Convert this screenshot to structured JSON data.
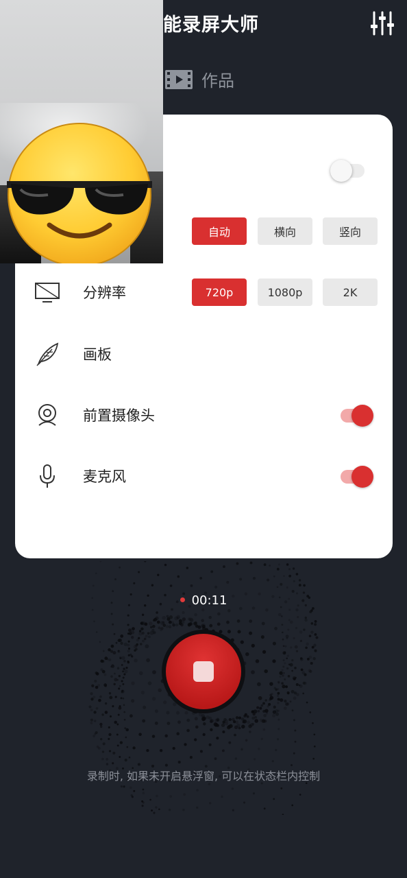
{
  "header": {
    "title": "全能录屏大师",
    "settings_icon": "sliders-icon"
  },
  "tabs": [
    {
      "label": "作品",
      "icon": "film-icon"
    }
  ],
  "settings": {
    "floating_window_toggle": {
      "on": false
    },
    "orientation": {
      "options": [
        "自动",
        "横向",
        "竖向"
      ],
      "selected": "自动"
    },
    "resolution": {
      "label": "分辨率",
      "icon": "monitor-icon",
      "options": [
        "720p",
        "1080p",
        "2K"
      ],
      "selected": "720p"
    },
    "canvas": {
      "label": "画板",
      "icon": "feather-icon"
    },
    "front_camera": {
      "label": "前置摄像头",
      "icon": "webcam-icon",
      "on": true
    },
    "microphone": {
      "label": "麦克风",
      "icon": "microphone-icon",
      "on": true
    }
  },
  "recording": {
    "timer": "00:11",
    "hint": "录制时, 如果未开启悬浮窗, 可以在状态栏内控制"
  },
  "colors": {
    "background": "#1f232b",
    "accent": "#d93030",
    "card": "#ffffff"
  }
}
